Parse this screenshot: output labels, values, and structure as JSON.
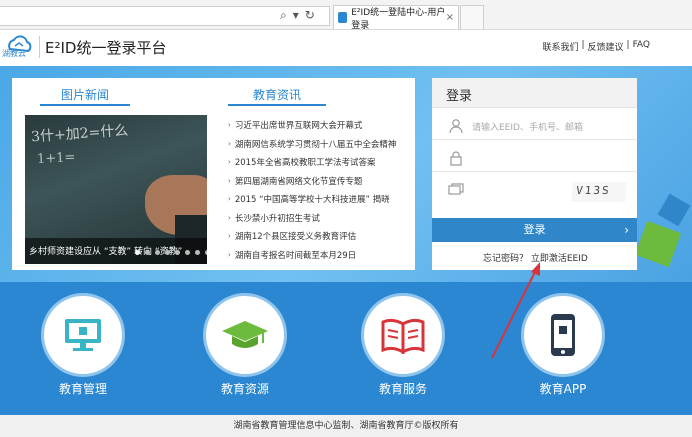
{
  "browser": {
    "tab_title": "E²ID统一登陆中心-用户登录",
    "tab_close": "×"
  },
  "header": {
    "logo_text": "湖教云",
    "title": "E²ID统一登录平台",
    "links": [
      "联系我们",
      "|",
      "反馈建议",
      "|",
      "FAQ"
    ]
  },
  "news": {
    "tab_pictures": "图片新闻",
    "tab_education": "教育资讯",
    "photo_caption": "乡村师资建设应从 “支教” 转向 “资教”",
    "photo_chalk_line1": "3什+加2=什么",
    "photo_chalk_line2": "1+1=",
    "slide_dots": 8,
    "active_dot": 0,
    "items": [
      "习近平出席世界互联网大会开幕式",
      "湖南网信系统学习贯彻十八届五中全会精神",
      "2015年全省高校教职工学法考试答案",
      "第四届湖南省网络文化节宣传专题",
      "2015 “中国高等学校十大科技进展” 揭晓",
      "长沙禁小升初招生考试",
      "湖南12个县区接受义务教育评估",
      "湖南自考报名时间截至本月29日"
    ]
  },
  "login": {
    "title": "登录",
    "username_placeholder": "请输入EEID、手机号、邮箱",
    "captcha_text": "V13S",
    "button_label": "登录",
    "button_chevron": "›",
    "forgot_text": "忘记密码？ 立即激活EEID"
  },
  "services": [
    {
      "label": "教育管理",
      "icon": "monitor-icon"
    },
    {
      "label": "教育资源",
      "icon": "graduation-cap-icon"
    },
    {
      "label": "教育服务",
      "icon": "book-icon"
    },
    {
      "label": "教育APP",
      "icon": "phone-icon"
    }
  ],
  "footer": {
    "text": "湖南省教育管理信息中心监制、湖南省教育厅©版权所有"
  },
  "colors": {
    "brand_blue": "#2b87d1",
    "hero_light": "#71c0f1",
    "accent_green": "#6dbb3c",
    "arrow_red": "#d9343a"
  }
}
